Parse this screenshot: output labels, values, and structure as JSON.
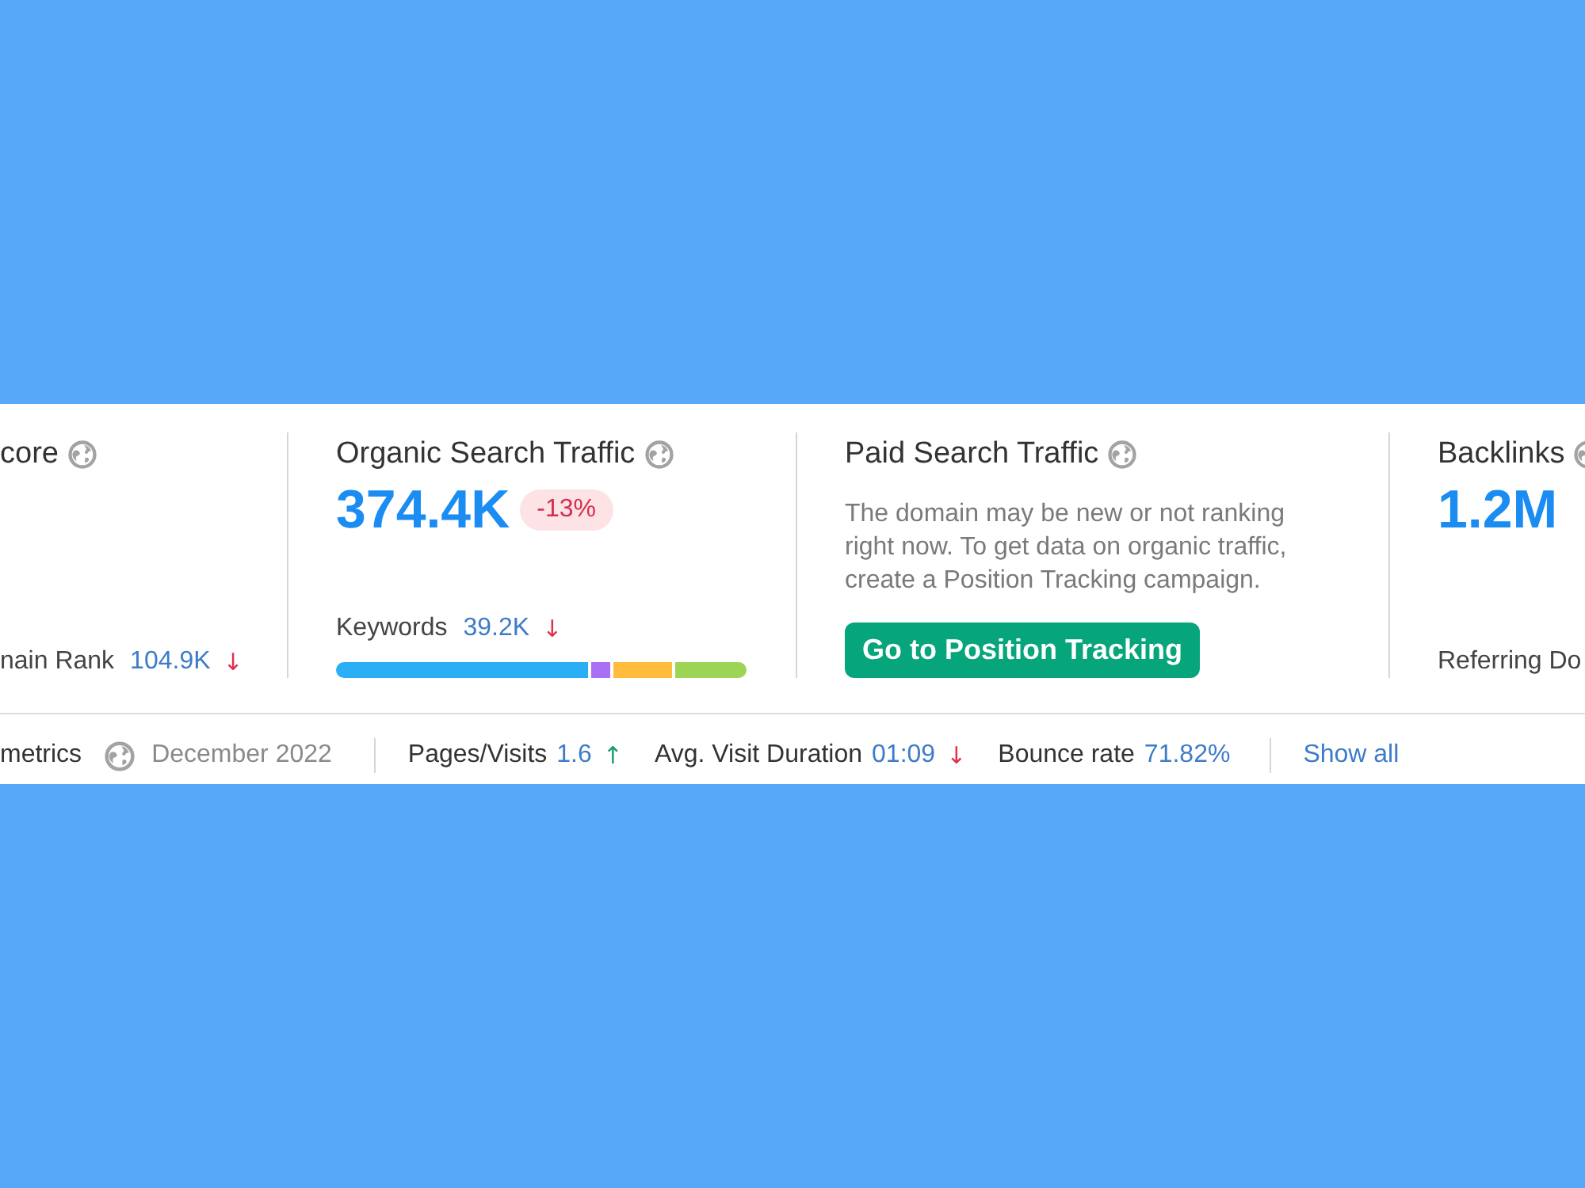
{
  "metric_cards": [
    {
      "kind": "metric",
      "title": "core",
      "footer": {
        "label": "nain Rank",
        "value": "104.9K",
        "arrow": "↓",
        "color": "#e0314b"
      }
    },
    {
      "kind": "metric",
      "title": "Organic Search Traffic",
      "value": "374.4K",
      "badge": "-13%",
      "footer": {
        "label": "Keywords",
        "value": "39.2K",
        "arrow": "↓",
        "color": "#e0314b"
      },
      "distribution_bar": true
    },
    {
      "kind": "prompt",
      "title": "Paid Search Traffic",
      "message": "The domain may be new or not ranking right now. To get data on organic traffic, create a Position Tracking campaign.",
      "button": "Go to Position Tracking"
    },
    {
      "kind": "metric",
      "title": "Backlinks",
      "value": "1.2M",
      "footer": {
        "label": "Referring Do"
      }
    }
  ],
  "metrics_bar": {
    "label": "metrics",
    "period": "December 2022",
    "items": [
      {
        "label": "Pages/Visits",
        "value": "1.6",
        "arrow": "↑",
        "color": "#1f9e6c"
      },
      {
        "label": "Avg. Visit Duration",
        "value": "01:09",
        "arrow": "↓",
        "color": "#e0314b"
      },
      {
        "label": "Bounce rate",
        "value": "71.82%"
      }
    ],
    "link": "Show all"
  }
}
